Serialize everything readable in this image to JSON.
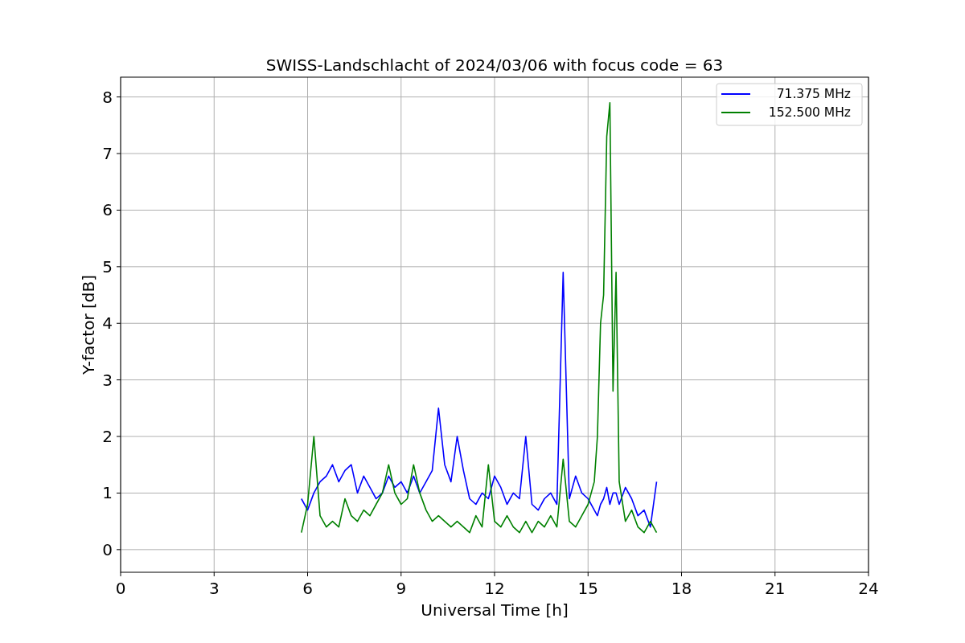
{
  "chart_data": {
    "type": "line",
    "title": "SWISS-Landschlacht of 2024/03/06 with focus code = 63",
    "xlabel": "Universal Time [h]",
    "ylabel": "Y-factor [dB]",
    "x": [
      5.8,
      6.0,
      6.2,
      6.4,
      6.6,
      6.8,
      7.0,
      7.2,
      7.4,
      7.6,
      7.8,
      8.0,
      8.2,
      8.4,
      8.6,
      8.8,
      9.0,
      9.2,
      9.4,
      9.6,
      9.8,
      10.0,
      10.2,
      10.4,
      10.6,
      10.8,
      11.0,
      11.2,
      11.4,
      11.6,
      11.8,
      12.0,
      12.2,
      12.4,
      12.6,
      12.8,
      13.0,
      13.2,
      13.4,
      13.6,
      13.8,
      14.0,
      14.2,
      14.4,
      14.6,
      14.8,
      15.0,
      15.2,
      15.3,
      15.4,
      15.5,
      15.6,
      15.7,
      15.8,
      15.9,
      16.0,
      16.2,
      16.4,
      16.6,
      16.8,
      17.0,
      17.2
    ],
    "series": [
      {
        "name": "71.375 MHz",
        "color": "#0000ff",
        "values": [
          0.9,
          0.7,
          1.0,
          1.2,
          1.3,
          1.5,
          1.2,
          1.4,
          1.5,
          1.0,
          1.3,
          1.1,
          0.9,
          1.0,
          1.3,
          1.1,
          1.2,
          1.0,
          1.3,
          1.0,
          1.2,
          1.4,
          2.5,
          1.5,
          1.2,
          2.0,
          1.4,
          0.9,
          0.8,
          1.0,
          0.9,
          1.3,
          1.1,
          0.8,
          1.0,
          0.9,
          2.0,
          0.8,
          0.7,
          0.9,
          1.0,
          0.8,
          4.9,
          0.9,
          1.3,
          1.0,
          0.9,
          0.7,
          0.6,
          0.8,
          0.9,
          1.1,
          0.8,
          1.0,
          1.0,
          0.8,
          1.1,
          0.9,
          0.6,
          0.7,
          0.4,
          1.2
        ]
      },
      {
        "name": "152.500 MHz",
        "color": "#008000",
        "values": [
          0.3,
          0.8,
          2.0,
          0.6,
          0.4,
          0.5,
          0.4,
          0.9,
          0.6,
          0.5,
          0.7,
          0.6,
          0.8,
          1.0,
          1.5,
          1.0,
          0.8,
          0.9,
          1.5,
          1.0,
          0.7,
          0.5,
          0.6,
          0.5,
          0.4,
          0.5,
          0.4,
          0.3,
          0.6,
          0.4,
          1.5,
          0.5,
          0.4,
          0.6,
          0.4,
          0.3,
          0.5,
          0.3,
          0.5,
          0.4,
          0.6,
          0.4,
          1.6,
          0.5,
          0.4,
          0.6,
          0.8,
          1.2,
          2.0,
          4.0,
          4.5,
          7.3,
          7.9,
          2.8,
          4.9,
          1.2,
          0.5,
          0.7,
          0.4,
          0.3,
          0.5,
          0.3
        ]
      }
    ],
    "grid": true,
    "legend": true,
    "xlim": [
      0,
      24
    ],
    "ylim": [
      -0.4,
      8.35
    ],
    "xticks": [
      0,
      3,
      6,
      9,
      12,
      15,
      18,
      21,
      24
    ],
    "yticks": [
      0,
      1,
      2,
      3,
      4,
      5,
      6,
      7,
      8
    ]
  }
}
